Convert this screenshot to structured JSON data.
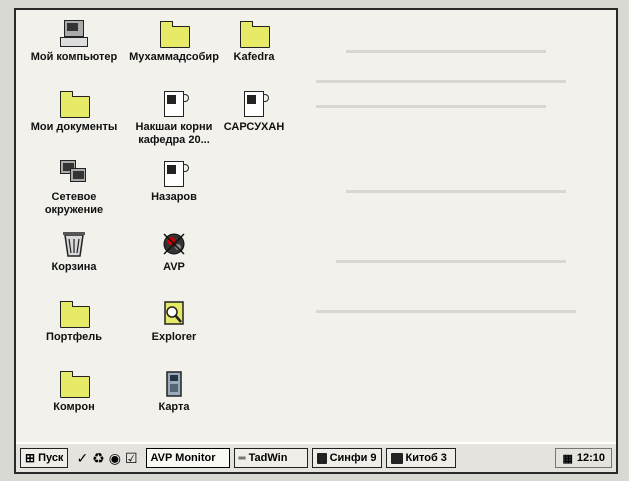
{
  "desktop": {
    "icons": [
      {
        "label": "Мой компьютер",
        "icon": "computer-icon"
      },
      {
        "label": "Мухаммадсобир",
        "icon": "folder-icon"
      },
      {
        "label": "Kafedra",
        "icon": "folder-icon"
      },
      {
        "label": "Мои документы",
        "icon": "folder-icon"
      },
      {
        "label": "Накшаи корни кафедра 20...",
        "icon": "document-icon"
      },
      {
        "label": "САРСУХАН",
        "icon": "document-icon"
      },
      {
        "label": "Сетевое окружение",
        "icon": "network-icon"
      },
      {
        "label": "Назаров",
        "icon": "document-icon"
      },
      {
        "label": "Корзина",
        "icon": "recycle-bin-icon"
      },
      {
        "label": "AVP",
        "icon": "avp-icon"
      },
      {
        "label": "Портфель",
        "icon": "briefcase-icon"
      },
      {
        "label": "Explorer",
        "icon": "explorer-icon"
      },
      {
        "label": "Комрон",
        "icon": "folder-icon"
      },
      {
        "label": "Карта",
        "icon": "map-icon"
      }
    ]
  },
  "taskbar": {
    "start_label": "Пуск",
    "tasks": [
      {
        "label": "AVP Monitor"
      },
      {
        "label": "TadWin"
      },
      {
        "label": "Синфи 9"
      },
      {
        "label": "Китоб 3"
      }
    ],
    "clock": "12:10"
  }
}
